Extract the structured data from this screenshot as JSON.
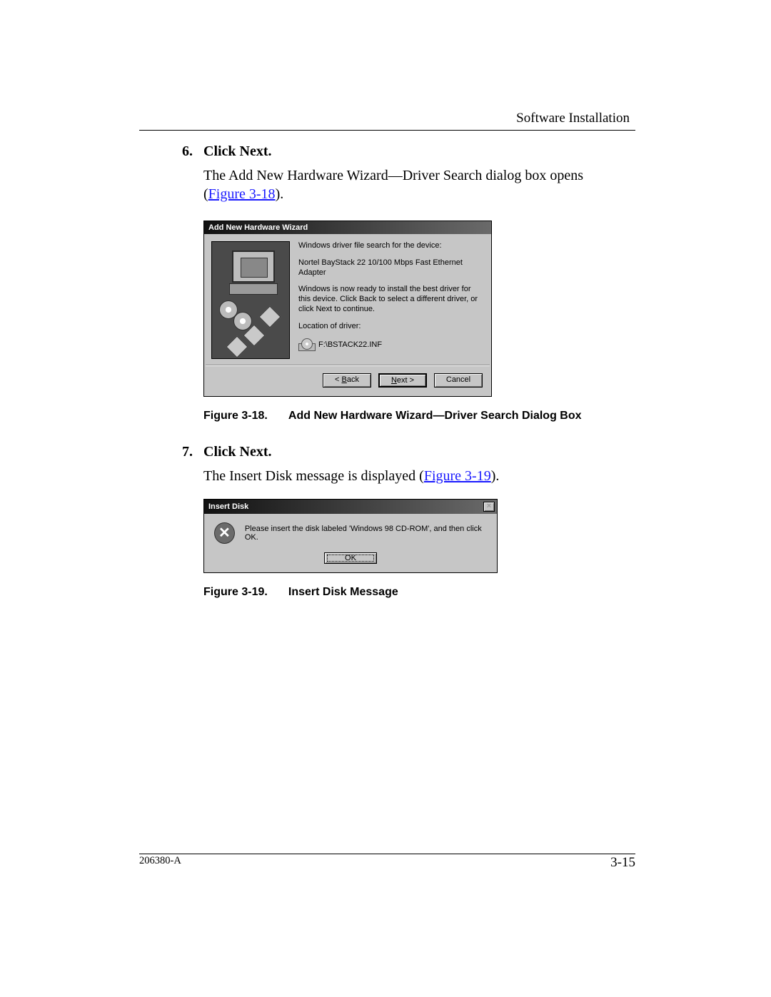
{
  "header": {
    "section_title": "Software Installation"
  },
  "steps": {
    "s6": {
      "num": "6.",
      "title": "Click Next.",
      "text_a": "The Add New Hardware Wizard—Driver Search dialog box opens (",
      "link": "Figure 3-18",
      "text_b": ")."
    },
    "s7": {
      "num": "7.",
      "title": "Click Next.",
      "text_a": "The Insert Disk message is displayed (",
      "link": "Figure 3-19",
      "text_b": ")."
    }
  },
  "wizard": {
    "title": "Add New Hardware Wizard",
    "line1": "Windows driver file search for the device:",
    "device": "Nortel BayStack 22 10/100 Mbps Fast Ethernet Adapter",
    "line2": "Windows is now ready to install the best driver for this device. Click Back to select a different driver, or click Next to continue.",
    "loc_label": "Location of driver:",
    "loc_value": "F:\\BSTACK22.INF",
    "btn_back_pre": "< ",
    "btn_back_u": "B",
    "btn_back_post": "ack",
    "btn_next_u": "N",
    "btn_next_post": "ext >",
    "btn_cancel": "Cancel"
  },
  "fig18": {
    "num": "Figure 3-18.",
    "caption": "Add New Hardware Wizard—Driver Search Dialog Box"
  },
  "msgbox": {
    "title": "Insert Disk",
    "close": "×",
    "icon": "✕",
    "text": "Please insert the disk labeled 'Windows 98 CD-ROM', and then click OK.",
    "ok": "OK"
  },
  "fig19": {
    "num": "Figure 3-19.",
    "caption": "Insert Disk Message"
  },
  "footer": {
    "docnum": "206380-A",
    "pagenum": "3-15"
  }
}
